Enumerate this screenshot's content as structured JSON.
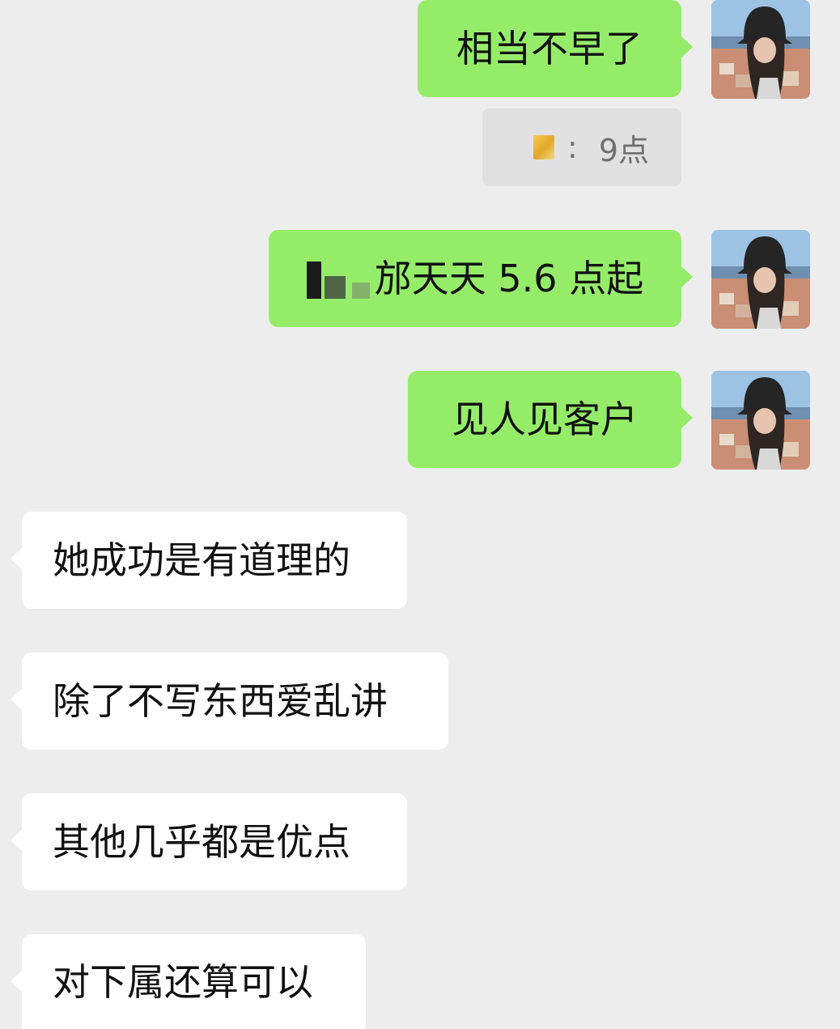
{
  "messages": [
    {
      "from": "me",
      "text": "相当不早了"
    },
    {
      "quote_sep": ":",
      "quote_text": "9点"
    },
    {
      "from": "me",
      "text": "都天天5.6点起",
      "visible_text": "邡天天 5.6 点起"
    },
    {
      "from": "me",
      "text": "见人见客户"
    },
    {
      "from": "other",
      "text": "她成功是有道理的"
    },
    {
      "from": "other",
      "text": "除了不写东西爱乱讲"
    },
    {
      "from": "other",
      "text": "其他几乎都是优点"
    },
    {
      "from": "other",
      "text": "对下属还算可以"
    }
  ],
  "colors": {
    "background": "#ededed",
    "sent_bubble": "#95ec69",
    "received_bubble": "#ffffff",
    "quote_bubble": "#e1e1e1"
  },
  "icons": {
    "avatar": "user-avatar-photo",
    "quote_sender": "blurred-sender-icon"
  }
}
